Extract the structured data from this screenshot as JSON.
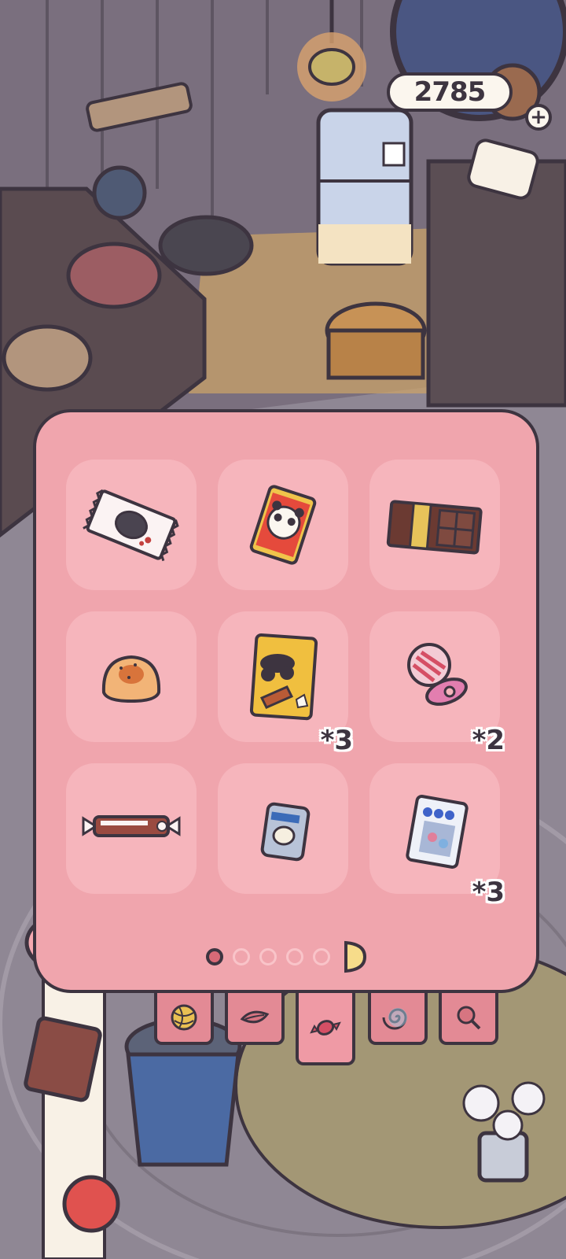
{
  "header": {
    "coins": "2785",
    "add_coins_label": "+"
  },
  "inventory": {
    "items": [
      {
        "name": "hard-candy-wrapper",
        "quantity": ""
      },
      {
        "name": "panda-snack-pack",
        "quantity": ""
      },
      {
        "name": "chocolate-bar",
        "quantity": ""
      },
      {
        "name": "bread-bun",
        "quantity": ""
      },
      {
        "name": "cookie-chip-bag",
        "quantity": "*3"
      },
      {
        "name": "pacifier-lollipop",
        "quantity": "*2"
      },
      {
        "name": "wrapped-candy-stick",
        "quantity": ""
      },
      {
        "name": "small-snack-box",
        "quantity": ""
      },
      {
        "name": "candy-packet",
        "quantity": "*3"
      }
    ],
    "pages_total": 5,
    "page_current": 1
  },
  "tabs": [
    {
      "icon": "yarn-ball-icon",
      "active": false
    },
    {
      "icon": "leaf-icon",
      "active": false
    },
    {
      "icon": "candy-icon",
      "active": true
    },
    {
      "icon": "snail-shell-icon",
      "active": false
    },
    {
      "icon": "magnifier-icon",
      "active": false
    }
  ],
  "colors": {
    "panel": "#f0a5ad",
    "slot": "#f6b5bc",
    "outline": "#3d3440",
    "active_dot": "#d86a77"
  }
}
